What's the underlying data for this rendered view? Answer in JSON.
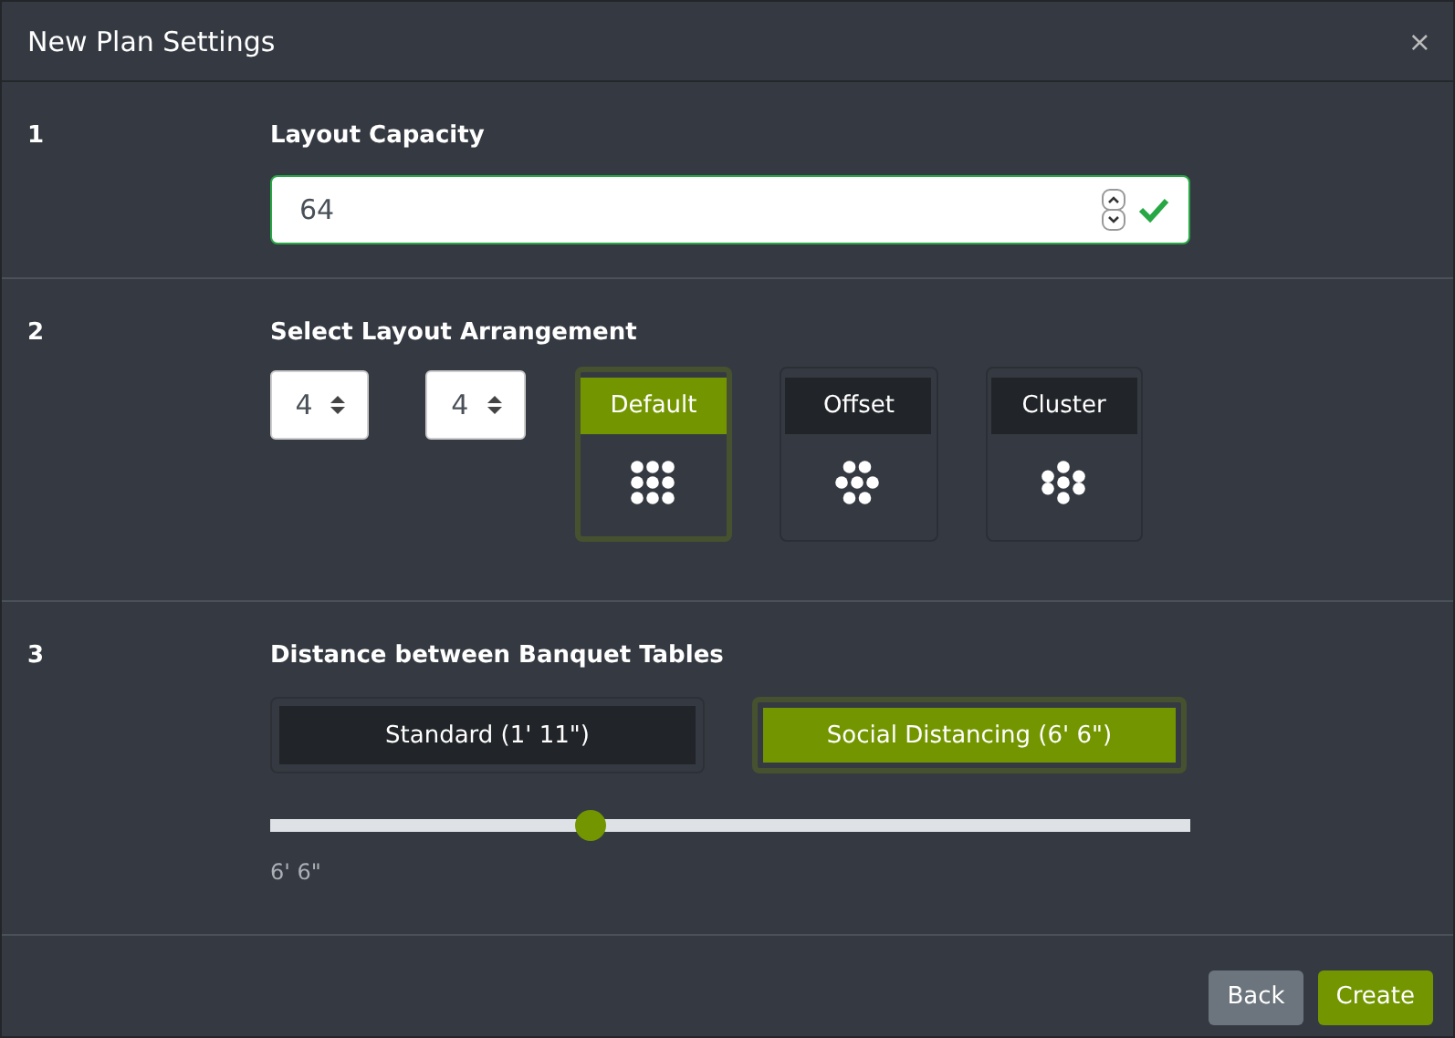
{
  "window": {
    "title": "New Plan Settings",
    "close": "×"
  },
  "capacity": {
    "number": "1",
    "label": "Layout Capacity",
    "value": "64",
    "valid": true
  },
  "arrangement": {
    "number": "2",
    "label": "Select Layout Arrangement",
    "rows": "4",
    "columns": "4",
    "options": [
      {
        "label": "Default",
        "kind": "grid",
        "selected": true
      },
      {
        "label": "Offset",
        "kind": "offset",
        "selected": false
      },
      {
        "label": "Cluster",
        "kind": "cluster",
        "selected": false
      }
    ]
  },
  "distance": {
    "number": "3",
    "label": "Distance between Banquet Tables",
    "options": [
      {
        "label": "Standard (1' 11\")",
        "selected": false
      },
      {
        "label": "Social Distancing (6' 6\")",
        "selected": true
      }
    ],
    "level": 0.35,
    "reading": "6' 6\""
  },
  "buttons": [
    {
      "label": "Back",
      "kind": "secondary"
    },
    {
      "label": "Create",
      "kind": "primary"
    }
  ]
}
